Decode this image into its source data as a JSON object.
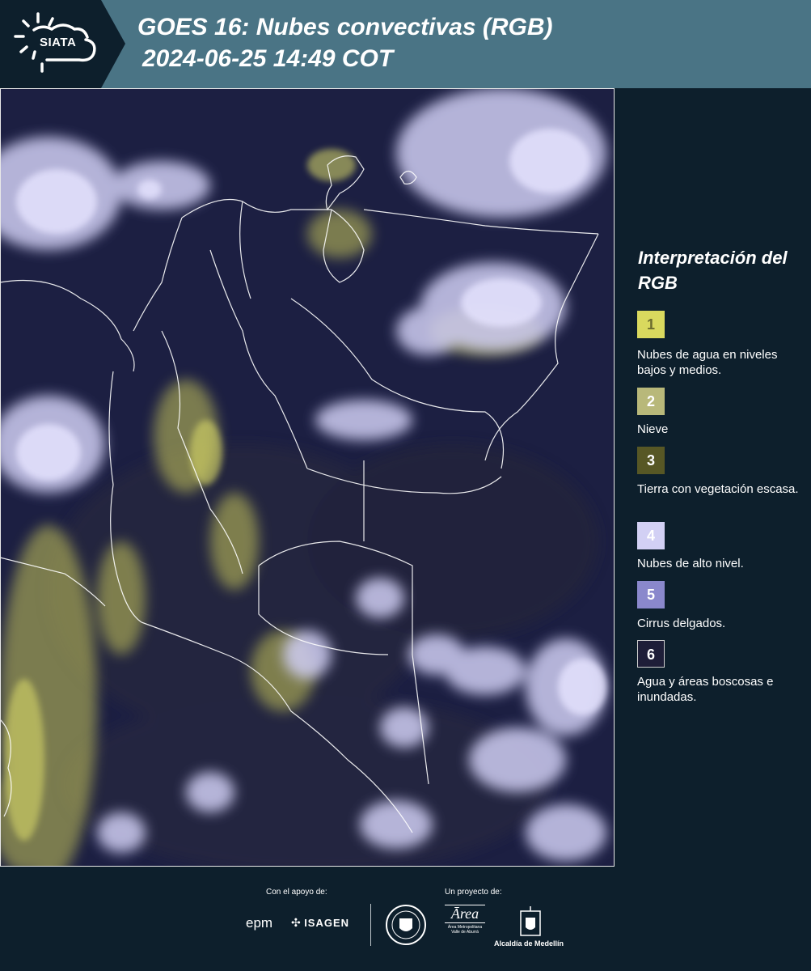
{
  "header": {
    "logo_text": "SIATA",
    "title_line1": "GOES 16: Nubes convectivas (RGB)",
    "title_line2": "2024-06-25 14:49 COT"
  },
  "legend": {
    "title": "Interpretación del RGB",
    "items": [
      {
        "number": "1",
        "label": "Nubes de agua en niveles bajos y medios.",
        "color": "#d9d95e"
      },
      {
        "number": "2",
        "label": "Nieve",
        "color": "#b8b87a"
      },
      {
        "number": "3",
        "label": "Tierra con vegetación escasa.",
        "color": "#575725"
      },
      {
        "number": "4",
        "label": "Nubes de alto nivel.",
        "color": "#d2d0f4"
      },
      {
        "number": "5",
        "label": "Cirrus delgados.",
        "color": "#8a88cc"
      },
      {
        "number": "6",
        "label": "Agua y áreas boscosas e inundadas.",
        "color": "#1e1e38"
      }
    ]
  },
  "footer": {
    "support_label": "Con el apoyo de:",
    "project_label": "Un proyecto de:",
    "sponsors": [
      "epm",
      "ISAGEN"
    ],
    "project_logos": [
      "Área Metropolitana Valle de Aburrá",
      "Alcaldía de Medellín"
    ]
  },
  "colors": {
    "header_bg": "#4a7485",
    "panel_bg": "#0d1f2c",
    "map_bg": "#1c1f42",
    "cloud_high": "#d2d0f4",
    "cloud_low": "#d9d95e"
  }
}
